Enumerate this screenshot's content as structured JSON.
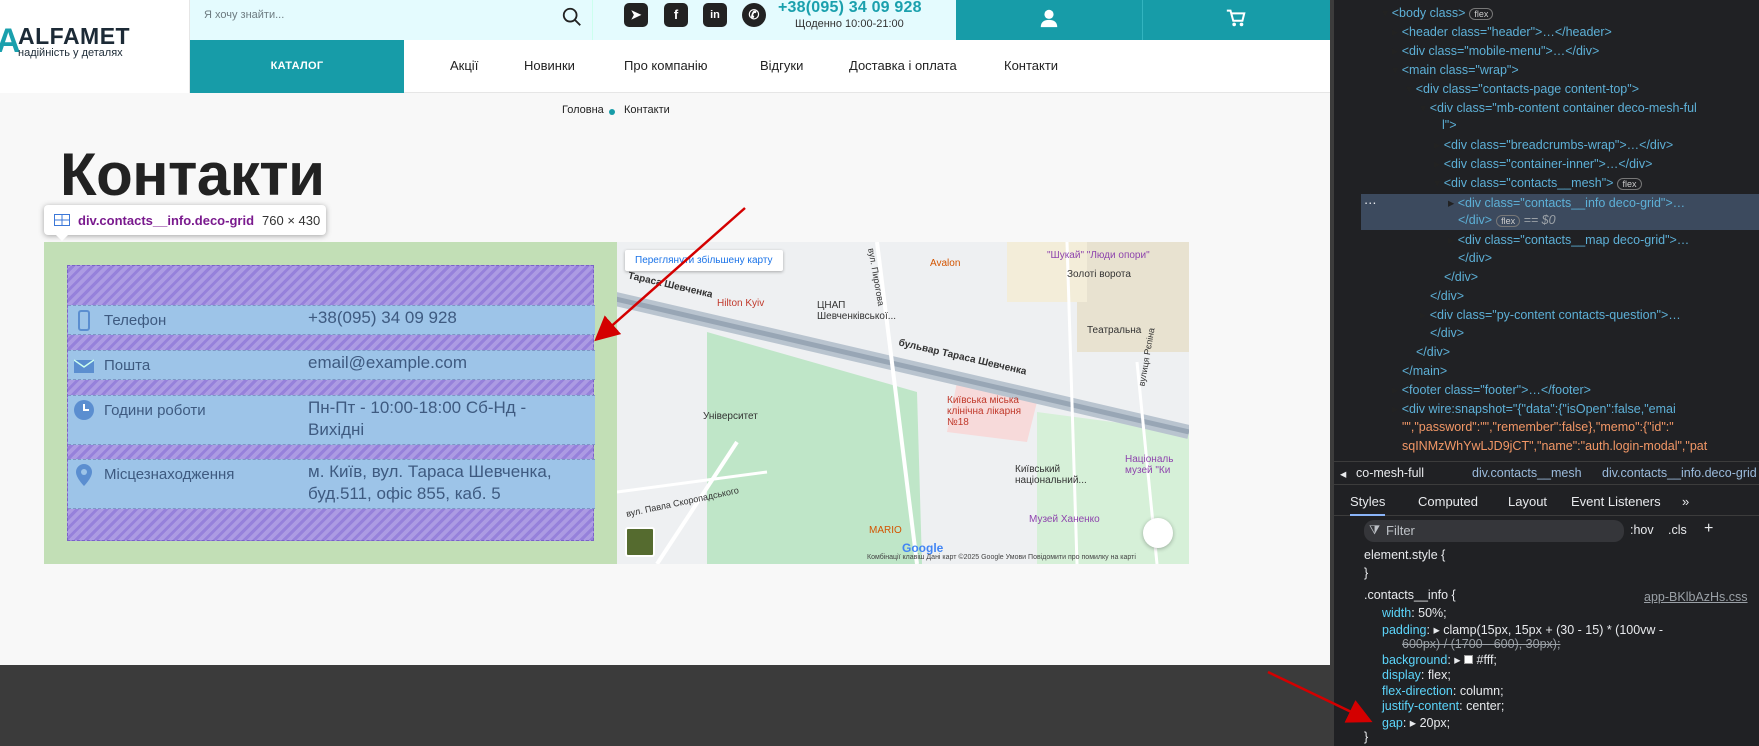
{
  "header": {
    "logo_name": "ALFAMET",
    "logo_tagline": "надійність у деталях",
    "search_placeholder": "Я хочу знайти...",
    "phone": "+38(095) 34 09 928",
    "hours": "Щоденно 10:00-21:00",
    "accent_color": "#179ca8",
    "social_icons": [
      "telegram-icon",
      "facebook-icon",
      "linkedin-icon",
      "whatsapp-icon"
    ]
  },
  "nav": {
    "catalog": "КАТАЛОГ",
    "items": [
      "Акції",
      "Новинки",
      "Про компанію",
      "Відгуки",
      "Доставка і оплата",
      "Контакти"
    ]
  },
  "breadcrumbs": {
    "home": "Головна",
    "current": "Контакти"
  },
  "page": {
    "title": "Контакти"
  },
  "inspect_tooltip": {
    "selector": "div.contacts__info.deco-grid",
    "size": "760 × 430"
  },
  "contacts": [
    {
      "icon": "phone-icon",
      "label": "Телефон",
      "value": "+38(095) 34 09 928"
    },
    {
      "icon": "mail-icon",
      "label": "Пошта",
      "value": "email@example.com"
    },
    {
      "icon": "clock-icon",
      "label": "Години роботи",
      "value": "Пн-Пт - 10:00-18:00 Сб-Нд - Вихідні"
    },
    {
      "icon": "location-icon",
      "label": "Місцезнаходження",
      "value": "м. Київ, вул. Тараса Шевченка, буд.511, офіс 855, каб. 5"
    }
  ],
  "map": {
    "button": "Переглянути збільшену карту",
    "labels": [
      "Тараса Шевченка",
      "Hilton Kyiv",
      "ЦНАП Шевченківської...",
      "Avalon",
      "\"Шукай\" \"Люди опори\"",
      "Золоті ворота",
      "Театральна",
      "бульвар Тараса Шевченка",
      "Київська міська клінічна лікарня №18",
      "Університет",
      "Київський національний...",
      "Національ музей \"Ки",
      "Музей Ханенко",
      "MARIO",
      "вул. Павла Скоропадського",
      "вулиця Рєпіна",
      "вул. Пирогова"
    ],
    "footer": "Комбінації клавіш   Дані карт ©2025 Google   Умови   Повідомити про помилку на карті",
    "google": "Google"
  },
  "devtools": {
    "dom": [
      {
        "text": "<body class>",
        "badge": "flex"
      },
      {
        "text": "<header class=\"header\">…</header>"
      },
      {
        "text": "<div class=\"mobile-menu\">…</div>"
      },
      {
        "text": "<main class=\"wrap\">"
      },
      {
        "text": "<div class=\"contacts-page content-top\">"
      },
      {
        "text": "<div class=\"mb-content container deco-mesh-ful"
      },
      {
        "text": "l\">"
      },
      {
        "text": "<div class=\"breadcrumbs-wrap\">…</div>"
      },
      {
        "text": "<div class=\"container-inner\">…</div>"
      },
      {
        "text": "<div class=\"contacts__mesh\">",
        "badge": "flex"
      },
      {
        "text": "<div class=\"contacts__info deco-grid\">…"
      },
      {
        "text": "</div>",
        "badge": "flex",
        "suffix": "== $0"
      },
      {
        "text": "<div class=\"contacts__map deco-grid\">…"
      },
      {
        "text": "</div>"
      },
      {
        "text": "</div>"
      },
      {
        "text": "</div>"
      },
      {
        "text": "<div class=\"py-content contacts-question\">…"
      },
      {
        "text": "</div>"
      },
      {
        "text": "</div>"
      },
      {
        "text": "</main>"
      },
      {
        "text": "<footer class=\"footer\">…</footer>"
      },
      {
        "text": "<div wire:snapshot=\"{\"data\":{\"isOpen\":false,\"emai"
      },
      {
        "text": "\"\",\"password\":\"\",\"remember\":false},\"memo\":{\"id\":\""
      },
      {
        "text": "sqINMzWhYwLJD9jCT\",\"name\":\"auth.login-modal\",\"pat"
      }
    ],
    "breadcrumb": [
      "co-mesh-full",
      "div.contacts__mesh",
      "div.contacts__info.deco-grid"
    ],
    "tabs": [
      "Styles",
      "Computed",
      "Layout",
      "Event Listeners"
    ],
    "filter_placeholder": "Filter",
    "filter_tools": [
      ":hov",
      ".cls"
    ],
    "css": {
      "element_style": "element.style {",
      "close": "}",
      "rule": ".contacts__info {",
      "source": "app-BKlbAzHs.css",
      "props": [
        {
          "name": "width",
          "value": "50%;"
        },
        {
          "name": "padding",
          "value": "clamp(15px, 15px + (30 - 15) * (100vw -"
        },
        {
          "name": "",
          "value": "600px) / (1700 - 600), 30px);"
        },
        {
          "name": "background",
          "value": "#fff;"
        },
        {
          "name": "display",
          "value": "flex;"
        },
        {
          "name": "flex-direction",
          "value": "column;"
        },
        {
          "name": "justify-content",
          "value": "center;"
        },
        {
          "name": "gap",
          "value": "20px;"
        }
      ]
    }
  }
}
